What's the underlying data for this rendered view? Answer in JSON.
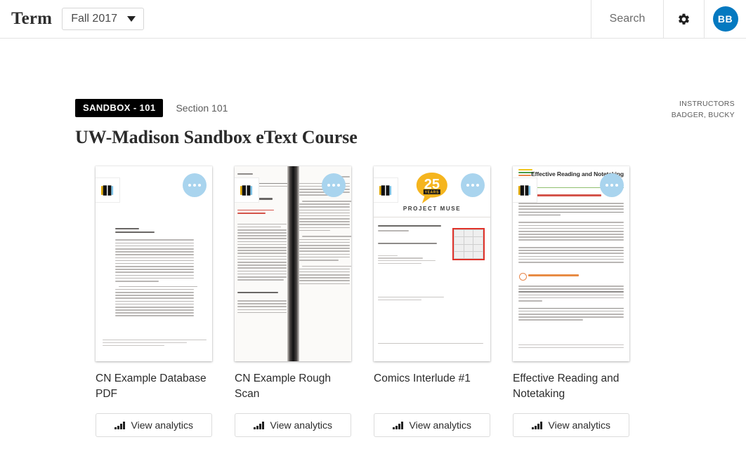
{
  "header": {
    "term_label": "Term",
    "term_value": "Fall 2017",
    "caret_icon": "chevron-down-icon",
    "search_label": "Search",
    "gear_icon": "gear-icon",
    "avatar_initials": "BB"
  },
  "course": {
    "badge": "SANDBOX - 101",
    "section": "Section 101",
    "title": "UW-Madison Sandbox eText Course",
    "instructors_label": "INSTRUCTORS",
    "instructors_value": "BADGER, BUCKY"
  },
  "books": [
    {
      "title": "CN Example Database PDF",
      "analytics_label": "View analytics",
      "menu_icon": "more-options-icon",
      "badge_icon": "book-icon",
      "analytics_icon": "bar-chart-icon"
    },
    {
      "title": "CN Example Rough Scan",
      "analytics_label": "View analytics",
      "menu_icon": "more-options-icon",
      "badge_icon": "book-icon",
      "analytics_icon": "bar-chart-icon"
    },
    {
      "title": "Comics Interlude #1",
      "analytics_label": "View analytics",
      "menu_icon": "more-options-icon",
      "badge_icon": "book-icon",
      "analytics_icon": "bar-chart-icon",
      "cover_logo_text": "PROJECT MUSE"
    },
    {
      "title": "Effective Reading and Notetaking",
      "analytics_label": "View analytics",
      "menu_icon": "more-options-icon",
      "badge_icon": "book-icon",
      "analytics_icon": "bar-chart-icon",
      "cover_heading": "Effective Reading and Notetaking"
    }
  ],
  "colors": {
    "avatar_blue": "#0479c0",
    "dots_blue": "#a9d4ee",
    "badge_black": "#000000",
    "muse_yellow": "#f5b51e"
  }
}
